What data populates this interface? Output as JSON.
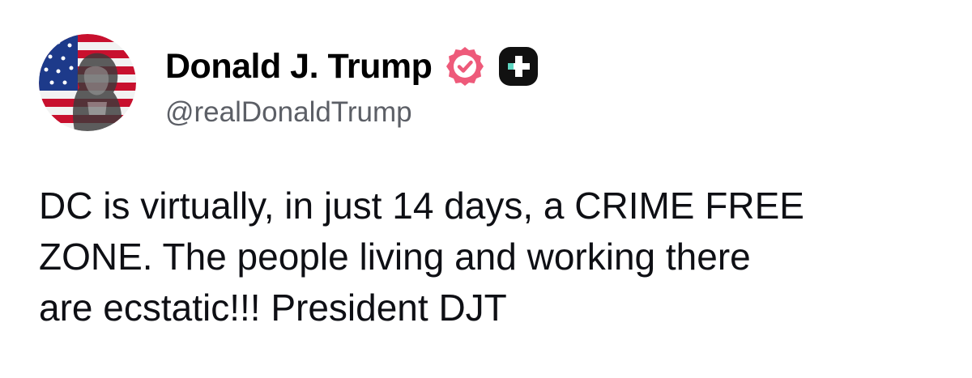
{
  "post": {
    "author": {
      "display_name": "Donald J. Trump",
      "handle": "@realDonaldTrump",
      "avatar_icon": "flag-portrait-avatar",
      "verified_icon": "verified-badge-icon",
      "platform_icon": "truth-social-icon"
    },
    "body_lines": [
      "DC is virtually, in just 14 days, a CRIME FREE",
      "ZONE. The people living and working there",
      "are ecstatic!!! President DJT"
    ]
  },
  "colors": {
    "verified_badge": "#ee5a7a",
    "platform_badge": "#111111",
    "platform_accent": "#5ed6c1",
    "text_primary": "#0e0f14",
    "text_secondary": "#5c5f66"
  }
}
